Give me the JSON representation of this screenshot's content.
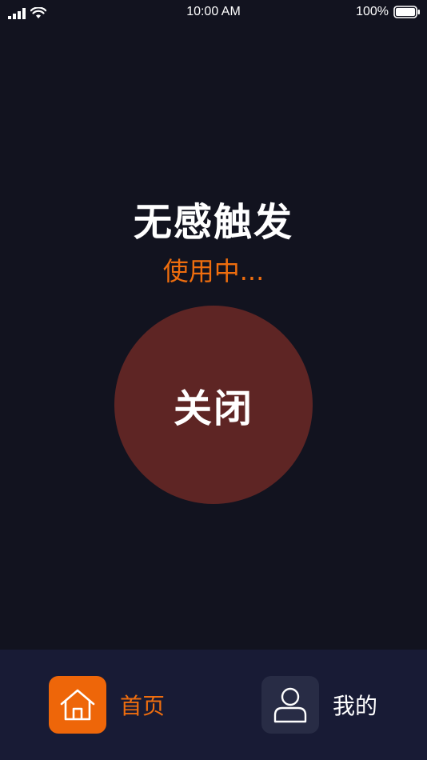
{
  "status_bar": {
    "time": "10:00 AM",
    "battery": "100%",
    "icons": [
      "signal-icon",
      "wifi-icon",
      "battery-icon"
    ]
  },
  "main": {
    "title": "无感触发",
    "status": "使用中...",
    "toggle_button_label": "关闭"
  },
  "bottom_nav": {
    "items": [
      {
        "label": "首页",
        "icon": "home-icon",
        "active": true
      },
      {
        "label": "我的",
        "icon": "user-icon",
        "active": false
      }
    ]
  },
  "colors": {
    "background": "#12131f",
    "accent": "#ee6d0e",
    "button_bg": "#5e2524",
    "nav_bg": "#181b35"
  }
}
